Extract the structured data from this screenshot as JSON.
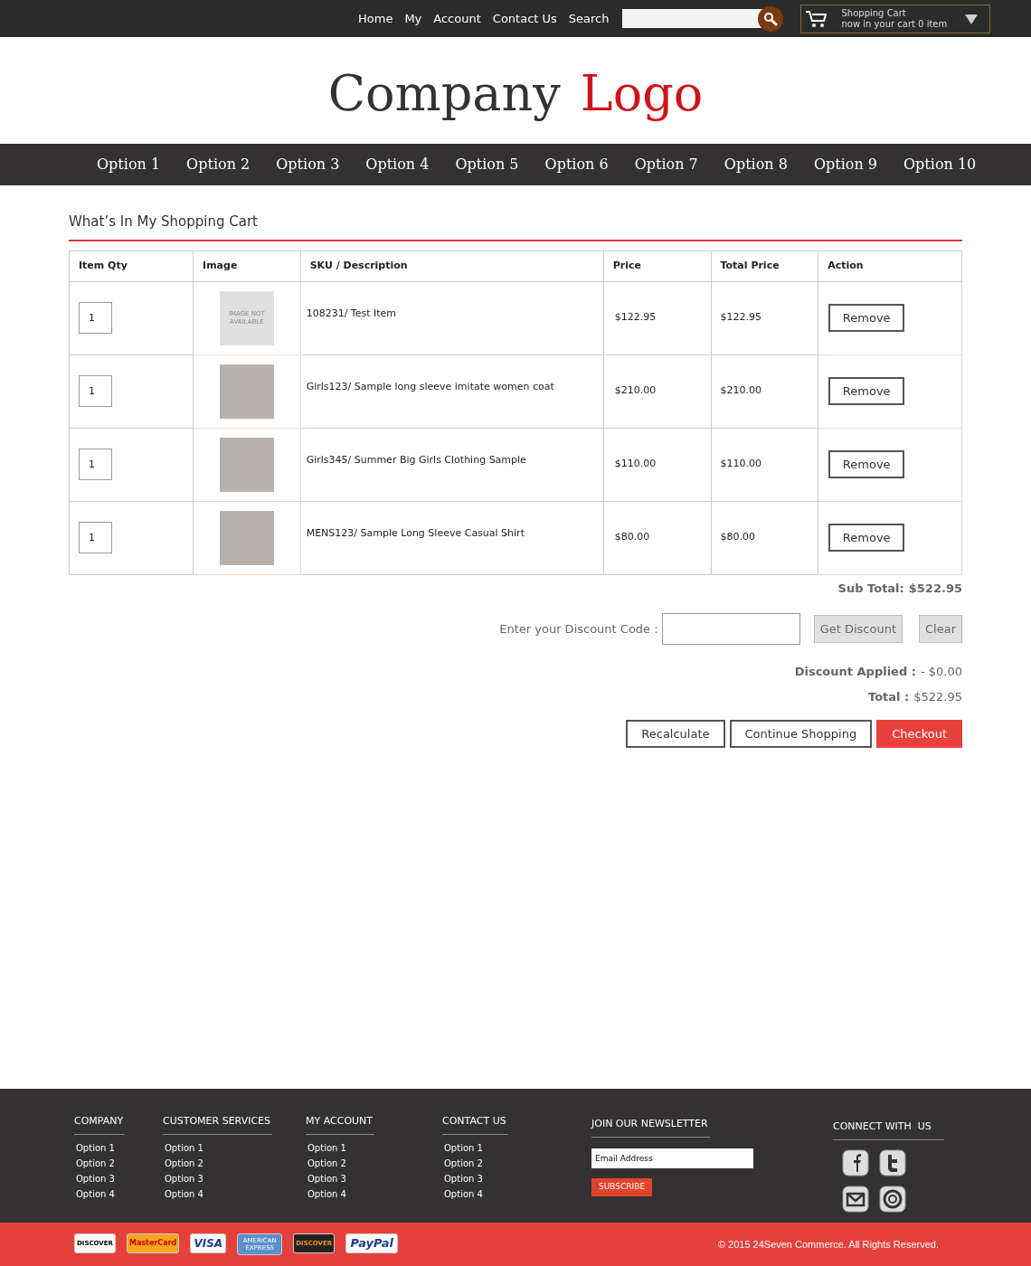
{
  "top_bar": {
    "links": [
      "Home",
      "My",
      "Account",
      "Contact Us",
      "Search"
    ],
    "cart": {
      "title": "Shopping Cart",
      "subtitle": "now in your cart 0 item"
    }
  },
  "logo": {
    "first": "Company",
    "second": "Logo"
  },
  "nav": [
    "Option 1",
    "Option 2",
    "Option 3",
    "Option 4",
    "Option 5",
    "Option 6",
    "Option 7",
    "Option 8",
    "Option 9",
    "Option 10"
  ],
  "cart": {
    "heading": "What’s In My Shopping Cart",
    "columns": [
      "Item Qty",
      "Image",
      "SKU / Description",
      "Price",
      "Total Price",
      "Action"
    ],
    "rows": [
      {
        "qty": "1",
        "image": {
          "kind": "placeholder",
          "text": "IMAGE NOT AVAILABLE"
        },
        "description": "108231/ Test Item",
        "price": "$122.95",
        "total": "$122.95",
        "action": "Remove"
      },
      {
        "qty": "1",
        "image": {
          "kind": "photo"
        },
        "description": "Girls123/ Sample long sleeve imitate women coat",
        "price": "$210.00",
        "total": "$210.00",
        "action": "Remove"
      },
      {
        "qty": "1",
        "image": {
          "kind": "photo"
        },
        "description": "Girls345/ Summer Big Girls Clothing Sample",
        "price": "$110.00",
        "total": "$110.00",
        "action": "Remove"
      },
      {
        "qty": "1",
        "image": {
          "kind": "photo"
        },
        "description": "MENS123/ Sample Long Sleeve Casual Shirt",
        "price": "$80.00",
        "total": "$80.00",
        "action": "Remove"
      }
    ],
    "sub_total": {
      "label": "Sub Total:",
      "value": "$522.95"
    },
    "discount": {
      "label": "Enter your Discount Code :",
      "apply": "Get Discount",
      "clear": "Clear"
    },
    "discount_applied": {
      "label": "Discount Applied :",
      "value": "- $0.00"
    },
    "total": {
      "label": "Total :",
      "value": "$522.95"
    },
    "buttons": [
      {
        "label": "Recalculate",
        "kind": "outline"
      },
      {
        "label": "Continue Shopping",
        "kind": "outline"
      },
      {
        "label": "Checkout",
        "kind": "primary"
      }
    ]
  },
  "footer": {
    "columns": [
      {
        "title": "COMPANY",
        "links": [
          "Option 1",
          "Option 2",
          "Option 3",
          "Option 4"
        ]
      },
      {
        "title": "CUSTOMER SERVICES",
        "links": [
          "Option 1",
          "Option 2",
          "Option 3",
          "Option 4"
        ]
      },
      {
        "title": "MY ACCOUNT",
        "links": [
          "Option 1",
          "Option 2",
          "Option 3",
          "Option 4"
        ]
      },
      {
        "title": "CONTACT US",
        "links": [
          "Option 1",
          "Option 2",
          "Option 3",
          "Option 4"
        ]
      }
    ],
    "newsletter": {
      "title": "JOIN OUR NEWSLETTER",
      "value": "Email Address",
      "button": "SUBSCRIBE"
    },
    "connect": {
      "title": "CONNECT WITH  US"
    }
  },
  "bottom_bar": {
    "payments": [
      {
        "label": "DISCOVER",
        "kind": "light"
      },
      {
        "label": "MasterCard",
        "kind": "mastercard"
      },
      {
        "label": "VISA",
        "kind": "visa"
      },
      {
        "label": "AMERICAN EXPRESS",
        "kind": "amex"
      },
      {
        "label": "DISCOVER",
        "kind": "dark"
      },
      {
        "label": "PayPal",
        "kind": "paypal"
      }
    ],
    "copyright": "© 2015 24Seven Commerce. All Rights Reserved."
  }
}
